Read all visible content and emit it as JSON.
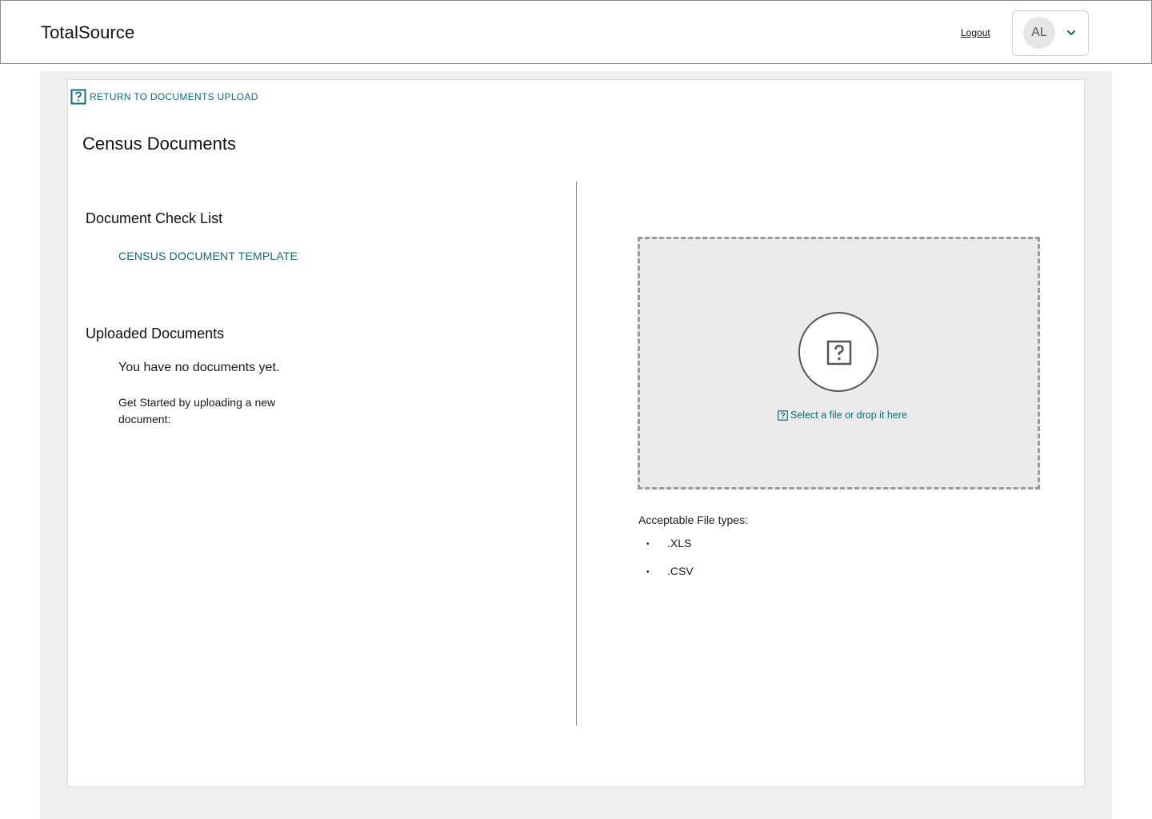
{
  "header": {
    "brand": "TotalSource",
    "logout_label": "Logout",
    "avatar_initials": "AL"
  },
  "nav": {
    "return_label": "RETURN TO DOCUMENTS UPLOAD"
  },
  "page": {
    "title": "Census Documents"
  },
  "checklist": {
    "heading": "Document Check List",
    "items": [
      "CENSUS DOCUMENT TEMPLATE"
    ]
  },
  "uploaded": {
    "heading": "Uploaded Documents",
    "empty_title": "You have no documents yet.",
    "empty_subtitle": "Get Started by uploading a new document:"
  },
  "dropzone": {
    "prompt": "Select a file or drop it here"
  },
  "file_types": {
    "label": "Acceptable File types:",
    "items": [
      ".XLS",
      ".CSV"
    ]
  },
  "colors": {
    "accent": "#0f6b78",
    "page_background": "#efefef",
    "dropzone_background": "#ebebeb"
  }
}
